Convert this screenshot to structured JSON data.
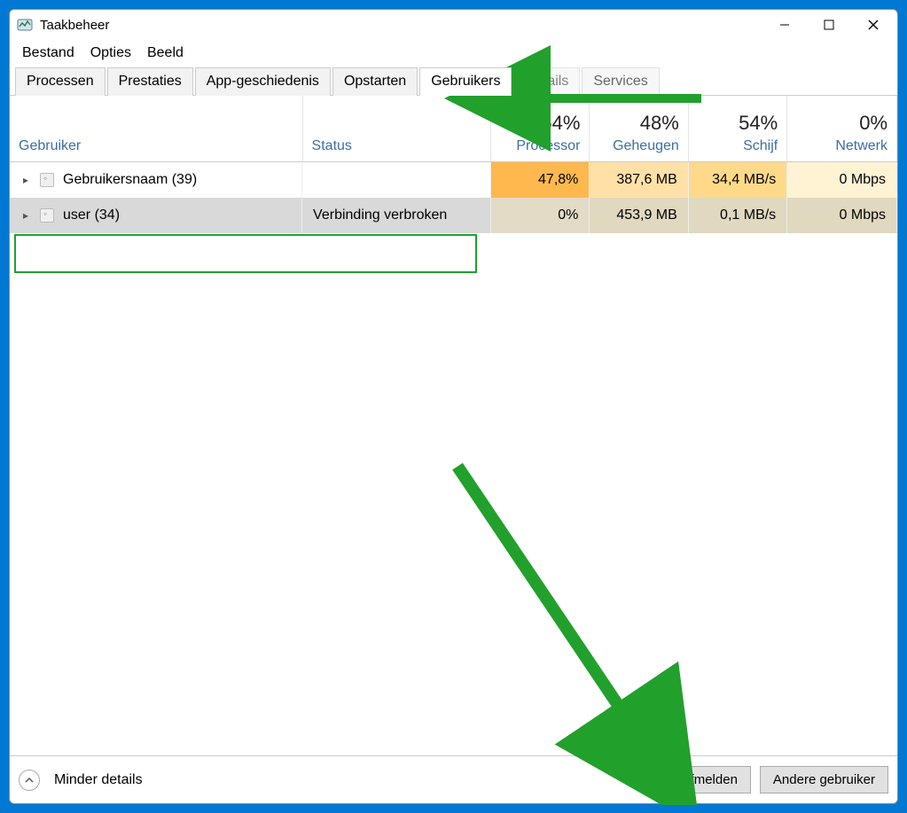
{
  "titlebar": {
    "title": "Taakbeheer"
  },
  "menu": {
    "file": "Bestand",
    "options": "Opties",
    "view": "Beeld"
  },
  "tabs": {
    "processes": "Processen",
    "performance": "Prestaties",
    "app_history": "App-geschiedenis",
    "startup": "Opstarten",
    "users": "Gebruikers",
    "details": "Details",
    "services": "Services"
  },
  "columns": {
    "user": "Gebruiker",
    "status": "Status",
    "cpu_pct": "54%",
    "cpu_label": "Processor",
    "mem_pct": "48%",
    "mem_label": "Geheugen",
    "disk_pct": "54%",
    "disk_label": "Schijf",
    "net_pct": "0%",
    "net_label": "Netwerk"
  },
  "rows": [
    {
      "name": "Gebruikersnaam (39)",
      "status": "",
      "cpu": "47,8%",
      "mem": "387,6 MB",
      "disk": "34,4 MB/s",
      "net": "0 Mbps"
    },
    {
      "name": "user (34)",
      "status": "Verbinding verbroken",
      "cpu": "0%",
      "mem": "453,9 MB",
      "disk": "0,1 MB/s",
      "net": "0 Mbps"
    }
  ],
  "footer": {
    "details": "Minder details",
    "signout": "Afmelden",
    "switch": "Andere gebruiker"
  }
}
